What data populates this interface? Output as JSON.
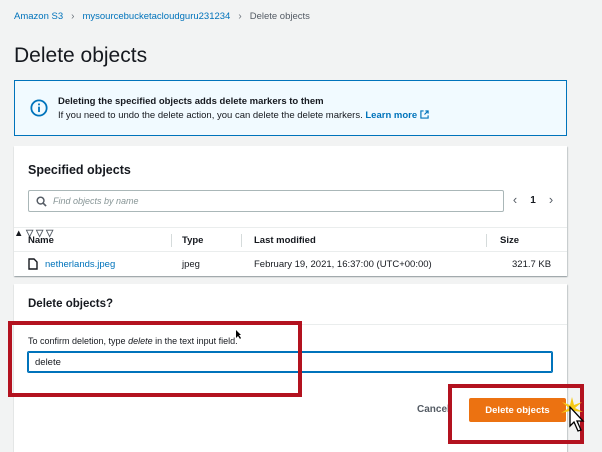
{
  "breadcrumb": {
    "items": [
      "Amazon S3",
      "mysourcebucketacloudguru231234"
    ],
    "current": "Delete objects"
  },
  "page_title": "Delete objects",
  "alert": {
    "icon": "info-icon",
    "title": "Deleting the specified objects adds delete markers to them",
    "body": "If you need to undo the delete action, you can delete the delete markers.",
    "link": "Learn more"
  },
  "specified": {
    "heading": "Specified objects",
    "search_placeholder": "Find objects by name",
    "page_number": "1",
    "columns": [
      "Name",
      "Type",
      "Last modified",
      "Size"
    ],
    "rows": [
      {
        "name": "netherlands.jpeg",
        "type": "jpeg",
        "last_modified": "February 19, 2021, 16:37:00 (UTC+00:00)",
        "size": "321.7 KB"
      }
    ]
  },
  "confirm": {
    "heading": "Delete objects?",
    "label_prefix": "To confirm deletion, type ",
    "label_keyword": "delete",
    "label_suffix": " in the text input field.",
    "input_value": "delete"
  },
  "actions": {
    "cancel": "Cancel",
    "delete": "Delete objects"
  },
  "colors": {
    "primary": "#ec7211",
    "link": "#0073bb",
    "highlight": "#b3121f"
  }
}
